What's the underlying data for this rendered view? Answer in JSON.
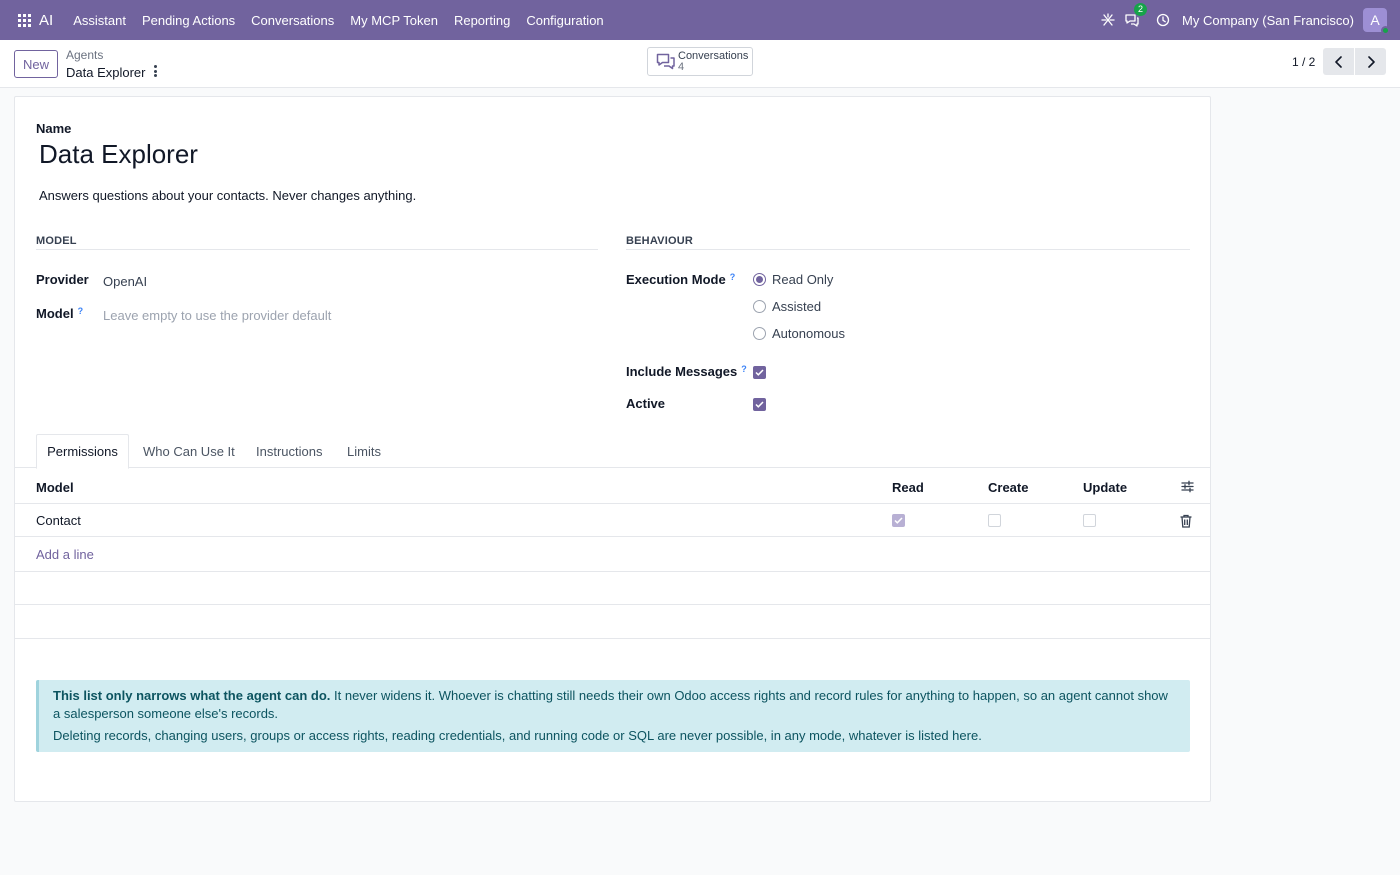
{
  "navbar": {
    "brand": "AI",
    "menu": [
      "Assistant",
      "Pending Actions",
      "Conversations",
      "My MCP Token",
      "Reporting",
      "Configuration"
    ],
    "messages_badge": "2",
    "company": "My Company (San Francisco)",
    "avatar_letter": "A"
  },
  "control": {
    "new_label": "New",
    "breadcrumb_parent": "Agents",
    "breadcrumb_current": "Data Explorer",
    "smart_button": {
      "label": "Conversations",
      "count": "4"
    },
    "pager": "1 / 2"
  },
  "form": {
    "name_label": "Name",
    "name_value": "Data Explorer",
    "description": "Answers questions about your contacts. Never changes anything.",
    "model_section": {
      "heading": "MODEL",
      "provider_label": "Provider",
      "provider_value": "OpenAI",
      "model_label": "Model",
      "model_placeholder": "Leave empty to use the provider default"
    },
    "behaviour_section": {
      "heading": "BEHAVIOUR",
      "execution_mode_label": "Execution Mode",
      "options": [
        "Read Only",
        "Assisted",
        "Autonomous"
      ],
      "selected_option": "Read Only",
      "include_messages_label": "Include Messages",
      "include_messages": true,
      "active_label": "Active",
      "active": true
    }
  },
  "tabs": [
    "Permissions",
    "Who Can Use It",
    "Instructions",
    "Limits"
  ],
  "active_tab": "Permissions",
  "permissions": {
    "columns": [
      "Model",
      "Read",
      "Create",
      "Update"
    ],
    "rows": [
      {
        "model": "Contact",
        "read": true,
        "create": false,
        "update": false
      }
    ],
    "add_line": "Add a line"
  },
  "alert": {
    "bold": "This list only narrows what the agent can do.",
    "text1": "It never widens it. Whoever is chatting still needs their own Odoo access rights and record rules for anything to happen, so an agent cannot show a salesperson someone else's records.",
    "text2": "Deleting records, changing users, groups or access rights, reading credentials, and running code or SQL are never possible, in any mode, whatever is listed here."
  },
  "colors": {
    "navbar": "#71639e",
    "accent": "#71639e",
    "help": "#3b82f6",
    "alert_bg": "#d1ecf1",
    "alert_text": "#0c5460",
    "badge": "#16a34a"
  }
}
